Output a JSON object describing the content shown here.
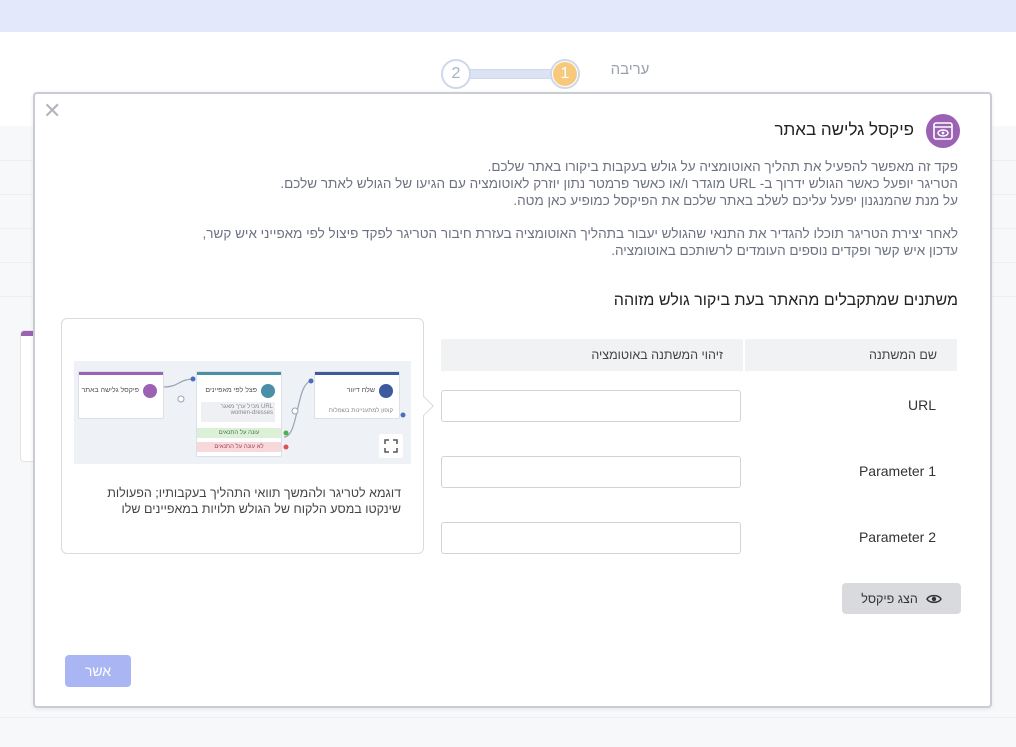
{
  "stepper": {
    "step1_number": "1",
    "step2_number": "2",
    "step1_label": "עריבה"
  },
  "modal": {
    "title": "פיקסל גלישה באתר",
    "description_lines": [
      "פקד זה מאפשר להפעיל את תהליך האוטומציה על גולש בעקבות ביקורו באתר שלכם.",
      "הטריגר יופעל כאשר הגולש ידרוך ב- URL מוגדר ו/או כאשר פרמטר נתון יוזרק לאוטומציה עם הגיעו של הגולש לאתר שלכם.",
      "על מנת שהמנגנון יפעל עליכם לשלב באתר שלכם את הפיקסל כמופיע כאן מטה."
    ],
    "description_lines_2": [
      "לאחר יצירת הטריגר תוכלו להגדיר את התנאי שהגולש יעבור בתהליך האוטומציה בעזרת חיבור הטריגר לפקד פיצול לפי מאפייני איש קשר,",
      "עדכון איש קשר ופקדים נוספים העומדים לרשותכם באוטומציה."
    ],
    "section_title": "משתנים שמתקבלים מהאתר בעת ביקור גולש מזוהה",
    "table": {
      "col_name": "שם המשתנה",
      "col_ident": "זיהוי המשתנה באוטומציה",
      "rows": [
        "URL",
        "Parameter 1",
        "Parameter 2"
      ]
    },
    "show_pixel_label": "הצג פיקסל",
    "confirm_label": "אשר",
    "example": {
      "caption": "דוגמא לטריגר ולהמשך תוואי התהליך בעקבותיו; הפעולות שינקטו במסע הלקוח של הגולש תלויות במאפיינים שלו",
      "node_trigger": "פיקסל גלישה באתר",
      "node_split": "פצל לפי מאפיינים",
      "node_split_rule": "URL מכיל ערך מאגר women-dresses",
      "node_yes": "עונה על התנאים",
      "node_no": "לא עונה על התנאים",
      "node_send": "שלח דיוור",
      "node_send_sub": "קופון למתעניינות בשמלות"
    },
    "colors": {
      "accent": "#9b62b4",
      "confirm": "#a9b6f3",
      "step_active": "#f6c97d"
    }
  }
}
